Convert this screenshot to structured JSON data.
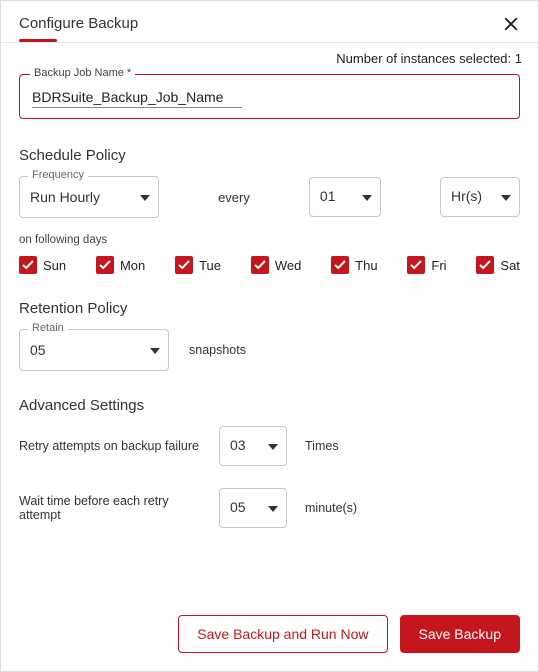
{
  "header": {
    "title": "Configure Backup"
  },
  "info": {
    "instances_text": "Number of instances selected: 1"
  },
  "job_name": {
    "label": "Backup Job Name *",
    "value": "BDRSuite_Backup_Job_Name"
  },
  "schedule": {
    "heading": "Schedule Policy",
    "frequency_label": "Frequency",
    "frequency_value": "Run Hourly",
    "every_label": "every",
    "every_value": "01",
    "unit_value": "Hr(s)",
    "days_label": "on following days",
    "days": [
      {
        "label": "Sun",
        "checked": true
      },
      {
        "label": "Mon",
        "checked": true
      },
      {
        "label": "Tue",
        "checked": true
      },
      {
        "label": "Wed",
        "checked": true
      },
      {
        "label": "Thu",
        "checked": true
      },
      {
        "label": "Fri",
        "checked": true
      },
      {
        "label": "Sat",
        "checked": true
      }
    ]
  },
  "retention": {
    "heading": "Retention Policy",
    "retain_label": "Retain",
    "retain_value": "05",
    "suffix": "snapshots"
  },
  "advanced": {
    "heading": "Advanced Settings",
    "retry_label": "Retry attempts on backup failure",
    "retry_value": "03",
    "retry_suffix": "Times",
    "wait_label": "Wait time before each retry attempt",
    "wait_value": "05",
    "wait_suffix": "minute(s)"
  },
  "footer": {
    "save_run_label": "Save Backup and Run Now",
    "save_label": "Save Backup"
  }
}
